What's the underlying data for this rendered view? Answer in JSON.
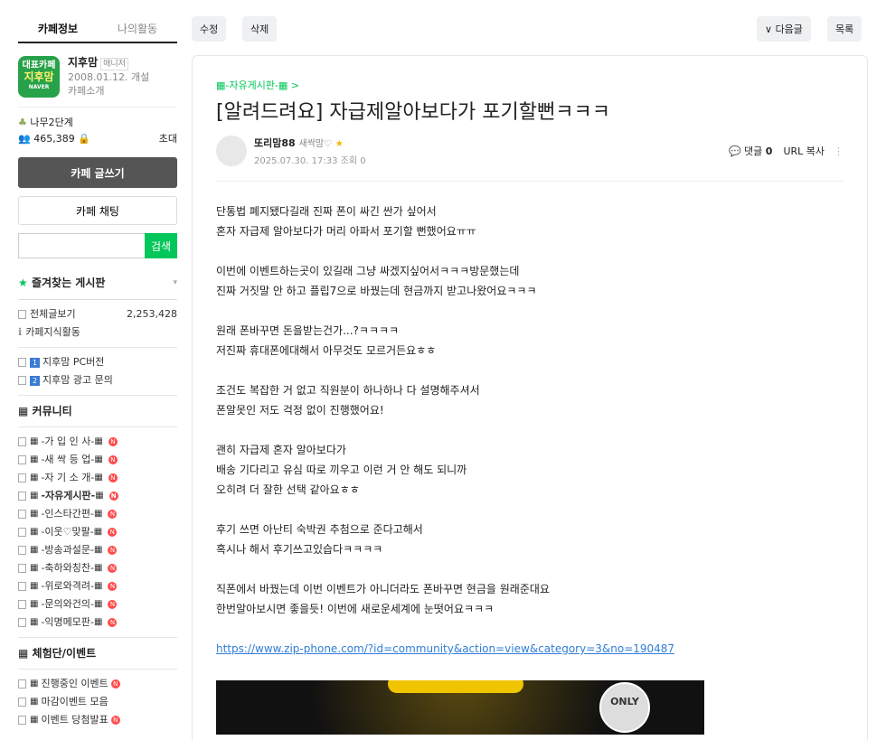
{
  "sidebar": {
    "tabs": [
      "카페정보",
      "나의활동"
    ],
    "logo_top": "대표카페",
    "logo_main": "지후맘",
    "logo_sub": "NAVER",
    "cafe_name": "지후맘",
    "manager": "매니저",
    "founded": "2008.01.12. 개설",
    "intro": "카페소개",
    "level": "나무2단계",
    "members": "465,389",
    "invite": "초대",
    "write_btn": "카페 글쓰기",
    "chat_btn": "카페 채팅",
    "search_btn": "검색",
    "favorites": "즐겨찾는 게시판",
    "all_posts": "전체글보기",
    "all_count": "2,253,428",
    "knowledge": "카페지식활동",
    "pc": "지후맘 PC버전",
    "ad": "지후맘 광고 문의",
    "group_community": "커뮤니티",
    "community": [
      "-가 입 인 사-",
      "-새 싹 등 업-",
      "-자 기 소 개-",
      "-자유게시판-",
      "-인스타간편-",
      "-이웃♡맞팔-",
      "-방송과설문-",
      "-축하와칭찬-",
      "-위로와격려-",
      "-문의와건의-",
      "-익명메모판-"
    ],
    "group_event": "체험단/이벤트",
    "events": [
      "진행중인 이벤트",
      "마감이벤트 모음",
      "이벤트 당첨발표"
    ]
  },
  "toolbar": {
    "edit": "수정",
    "delete": "삭제",
    "next": "다음글",
    "list": "목록"
  },
  "article": {
    "board": "-자유게시판-",
    "title": "[알려드려요] 자급제알아보다가 포기할뻔ㅋㅋㅋ",
    "author": "또리맘88",
    "grade": "새싹맘♡",
    "date": "2025.07.30. 17:33",
    "views": "조회 0",
    "comments_label": "댓글",
    "comments": "0",
    "url_copy": "URL 복사",
    "paragraphs": [
      [
        "단통법 폐지됐다길래 진짜 폰이 싸긴 싼가 싶어서",
        "혼자 자급제 알아보다가 머리 아파서 포기할 뻔했어요ㅠㅠ"
      ],
      [
        "이번에 이벤트하는곳이 있길래 그냥 싸겠지싶어서ㅋㅋㅋ방문했는데",
        "진짜 거짓말 안 하고 플립7으로 바꿨는데 현금까지 받고나왔어요ㅋㅋㅋ"
      ],
      [
        "원래 폰바꾸면 돈을받는건가...?ㅋㅋㅋㅋ",
        "저진짜 휴대폰에대해서 아무것도 모르거든요ㅎㅎ"
      ],
      [
        "조건도 복잡한 거 없고 직원분이 하나하나 다 설명해주셔서",
        "폰알못인 저도 걱정 없이 진행했어요!"
      ],
      [
        "괜히 자급제 혼자 알아보다가",
        "배송 기다리고 유심 따로 끼우고 이런 거 안 해도 되니까",
        "오히려 더 잘한 선택 같아요ㅎㅎ"
      ],
      [
        "후기 쓰면 아난티 숙박권 추첨으로 준다고해서",
        "혹시나 해서 후기쓰고있습다ㅋㅋㅋㅋ"
      ],
      [
        "직폰에서 바꿨는데 이번 이벤트가 아니더라도 폰바꾸면 현금을 원래준대요",
        "한번알아보시면 좋을듯! 이번에 새로운세계에 눈떳어요ㅋㅋㅋ"
      ]
    ],
    "link": "https://www.zip-phone.com/?id=community&action=view&category=3&no=190487",
    "image_text": "ONLY"
  }
}
